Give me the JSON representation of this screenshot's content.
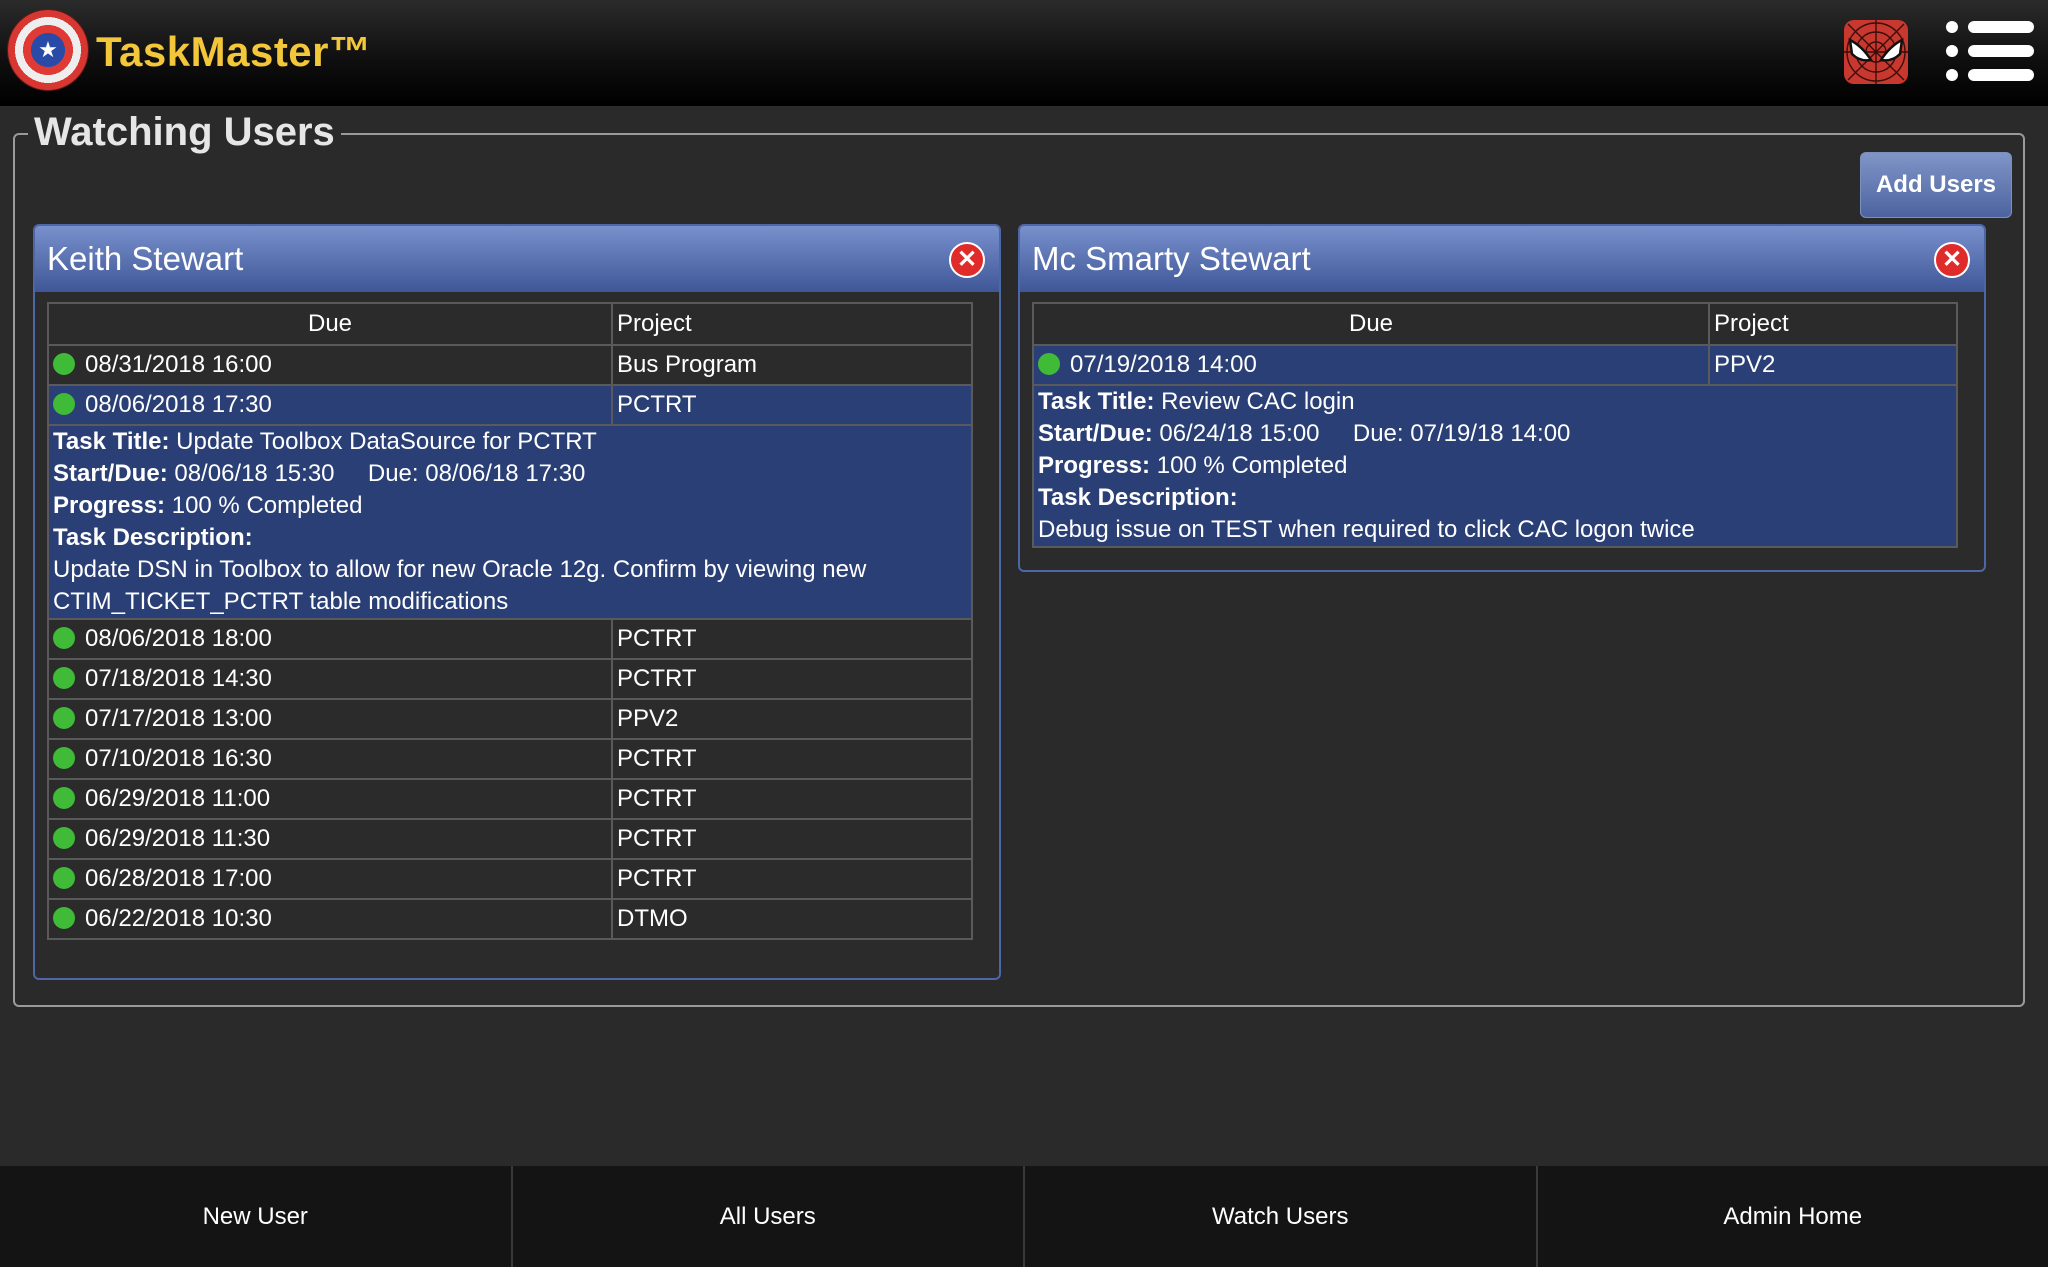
{
  "app": {
    "title": "TaskMaster™"
  },
  "colors": {
    "brand": "#f4c63a",
    "card_header": "#5870b0",
    "selected_row": "#2a3f75",
    "status_ok": "#3fbb37"
  },
  "icons": {
    "logo": "captain-shield-icon",
    "avatar": "spider-mask-icon",
    "menu": "hamburger-list-icon"
  },
  "page": {
    "title": "Watching Users",
    "add_users_label": "Add Users"
  },
  "columns": {
    "due": "Due",
    "project": "Project"
  },
  "labels": {
    "task_title": "Task Title:",
    "start_due": "Start/Due:",
    "due": "Due:",
    "progress": "Progress:",
    "task_description": "Task Description:"
  },
  "users": [
    {
      "name": "Keith Stewart",
      "rows_before": [
        {
          "due": "08/31/2018 16:00",
          "project": "Bus Program"
        }
      ],
      "selected": {
        "due": "08/06/2018 17:30",
        "project": "PCTRT"
      },
      "detail": {
        "title": "Update Toolbox DataSource for PCTRT",
        "start": "08/06/18 15:30",
        "due": "08/06/18 17:30",
        "progress": "100 % Completed",
        "description": "Update DSN in Toolbox to allow for new Oracle 12g. Confirm by viewing new CTIM_TICKET_PCTRT table modifications"
      },
      "rows_after": [
        {
          "due": "08/06/2018 18:00",
          "project": "PCTRT"
        },
        {
          "due": "07/18/2018 14:30",
          "project": "PCTRT"
        },
        {
          "due": "07/17/2018 13:00",
          "project": "PPV2"
        },
        {
          "due": "07/10/2018 16:30",
          "project": "PCTRT"
        },
        {
          "due": "06/29/2018 11:00",
          "project": "PCTRT"
        },
        {
          "due": "06/29/2018 11:30",
          "project": "PCTRT"
        },
        {
          "due": "06/28/2018 17:00",
          "project": "PCTRT"
        },
        {
          "due": "06/22/2018 10:30",
          "project": "DTMO"
        }
      ]
    },
    {
      "name": "Mc Smarty Stewart",
      "rows_before": [],
      "selected": {
        "due": "07/19/2018 14:00",
        "project": "PPV2"
      },
      "detail": {
        "title": "Review CAC login",
        "start": "06/24/18 15:00",
        "due": "07/19/18 14:00",
        "progress": "100 % Completed",
        "description": "Debug issue on TEST when required to click CAC logon twice"
      },
      "rows_after": []
    }
  ],
  "footer": {
    "tabs": [
      "New User",
      "All Users",
      "Watch Users",
      "Admin Home"
    ]
  }
}
